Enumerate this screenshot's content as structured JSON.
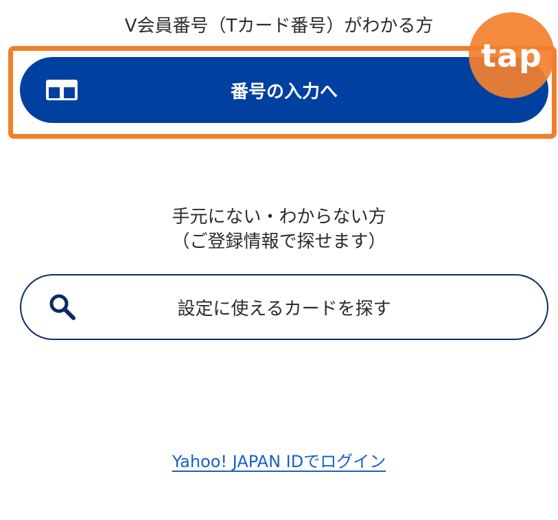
{
  "sections": {
    "known": {
      "label": "V会員番号（Tカード番号）がわかる方",
      "button_label": "番号の入力へ",
      "icon": "card-icon"
    },
    "unknown": {
      "label_line1": "手元にない・わからない方",
      "label_line2": "（ご登録情報で探せます）",
      "button_label": "設定に使えるカードを探す",
      "icon": "search-icon"
    }
  },
  "overlay": {
    "tap_text": "tap",
    "highlight_color": "#f07f2a"
  },
  "login": {
    "link_text": "Yahoo! JAPAN IDでログイン"
  },
  "colors": {
    "primary": "#0040a0",
    "outline": "#0a2a66",
    "link": "#1a5ec8"
  }
}
